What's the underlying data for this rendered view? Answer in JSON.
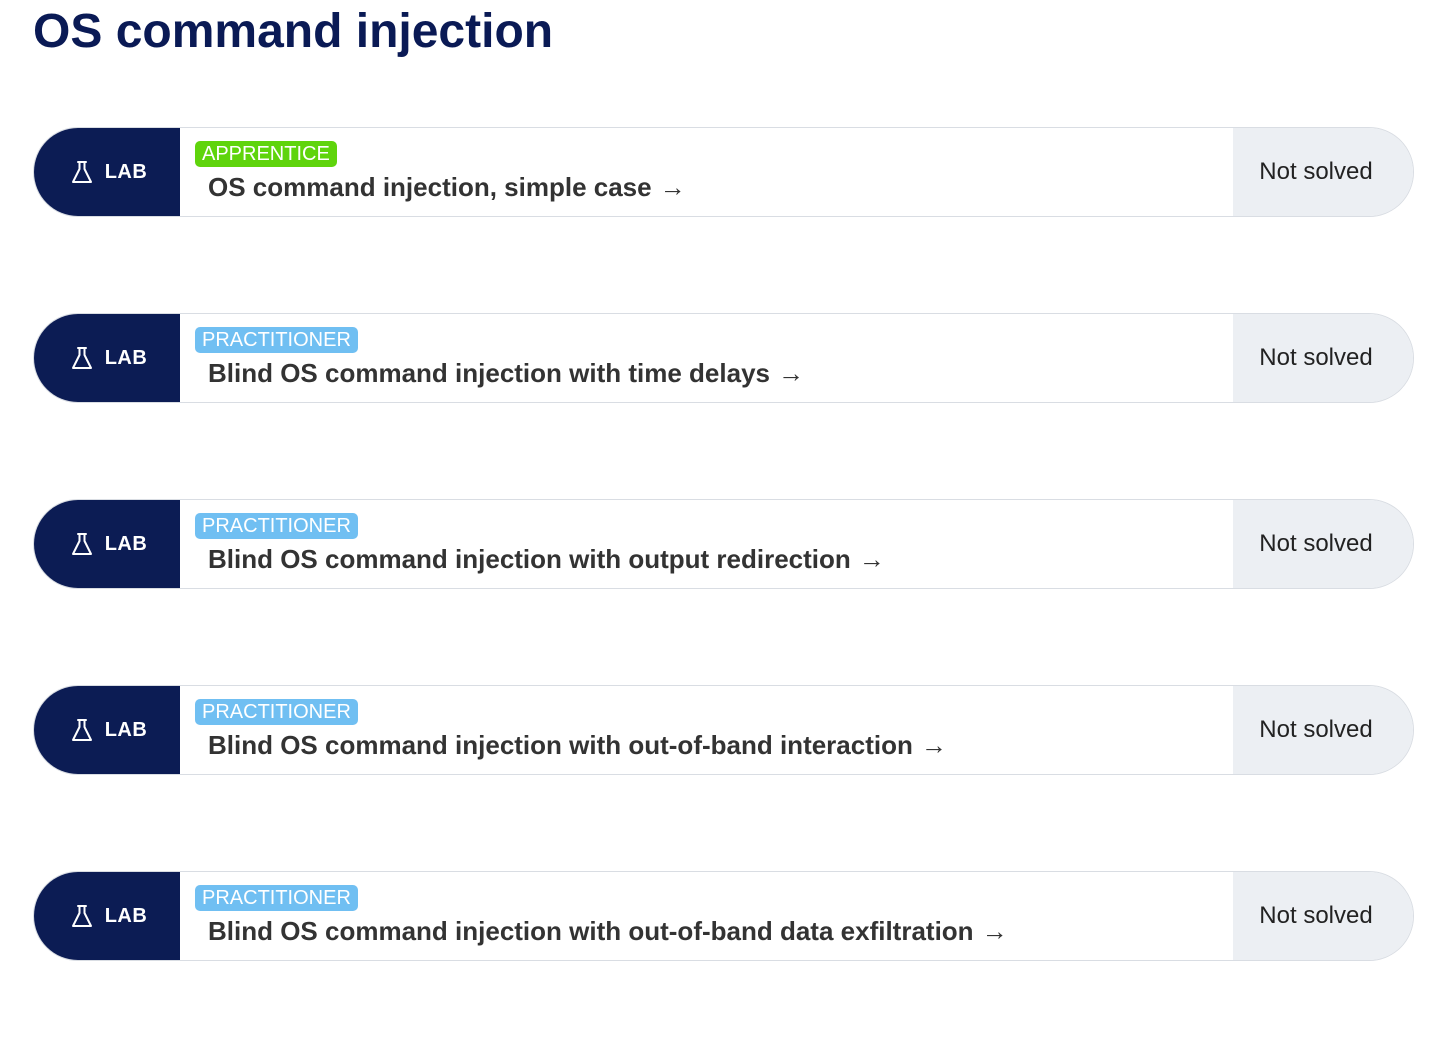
{
  "page": {
    "title": "OS command injection"
  },
  "colors": {
    "title": "#0a1a55",
    "lab_tag_bg": "#0c1c54",
    "apprentice_badge": "#5fd40c",
    "practitioner_badge": "#70bff2",
    "status_bg": "#eceff3"
  },
  "labs": [
    {
      "tag": "LAB",
      "tag_icon": "flask-icon",
      "level": "APPRENTICE",
      "title": "OS command injection, simple case",
      "arrow": "→",
      "status": "Not solved"
    },
    {
      "tag": "LAB",
      "tag_icon": "flask-icon",
      "level": "PRACTITIONER",
      "title": "Blind OS command injection with time delays",
      "arrow": "→",
      "status": "Not solved"
    },
    {
      "tag": "LAB",
      "tag_icon": "flask-icon",
      "level": "PRACTITIONER",
      "title": "Blind OS command injection with output redirection",
      "arrow": "→",
      "status": "Not solved"
    },
    {
      "tag": "LAB",
      "tag_icon": "flask-icon",
      "level": "PRACTITIONER",
      "title": "Blind OS command injection with out-of-band interaction",
      "arrow": "→",
      "status": "Not solved"
    },
    {
      "tag": "LAB",
      "tag_icon": "flask-icon",
      "level": "PRACTITIONER",
      "title": "Blind OS command injection with out-of-band data exfiltration",
      "arrow": "→",
      "status": "Not solved"
    }
  ]
}
